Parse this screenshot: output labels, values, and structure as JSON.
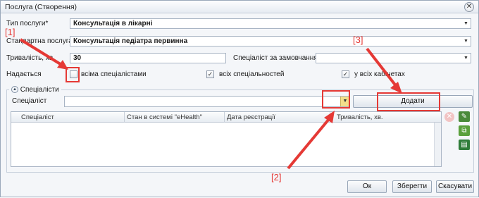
{
  "window": {
    "title": "Послуга (Створення)"
  },
  "form": {
    "service_type": {
      "label": "Тип послуги*",
      "value": "Консультація в лікарні"
    },
    "standard_service": {
      "label": "Стандартна послуга",
      "value": "Консультація педіатра первинна"
    },
    "duration": {
      "label": "Тривалість, хв",
      "value": "30"
    },
    "default_specialist": {
      "label": "Спеціаліст за замовчанням",
      "value": ""
    },
    "provided": {
      "label": "Надається",
      "all_specialists": {
        "label": "всіма спеціалістами",
        "checked": false
      },
      "all_specialties": {
        "label": "всіх спеціальностей",
        "checked": true
      },
      "all_offices": {
        "label": "у всіх кабінетах",
        "checked": true
      }
    }
  },
  "specialists_section": {
    "title": "Спеціалісти",
    "specialist_label": "Спеціаліст",
    "specialist_value": "",
    "add_button": "Додати",
    "columns": [
      "Спеціаліст",
      "Стан в системі \"eHealth\"",
      "Дата реєстрації",
      "Тривалість, хв."
    ]
  },
  "footer": {
    "ok": "Ок",
    "save": "Зберегти",
    "cancel": "Скасувати"
  },
  "annotations": [
    "[1]",
    "[2]",
    "[3]"
  ],
  "icons": {
    "close": "close-icon",
    "delete": "delete-icon",
    "edit": "edit-icon",
    "copy": "copy-icon",
    "export": "export-icon"
  },
  "colors": {
    "annotation": "#e53935",
    "accent": "#3a7bd5"
  }
}
